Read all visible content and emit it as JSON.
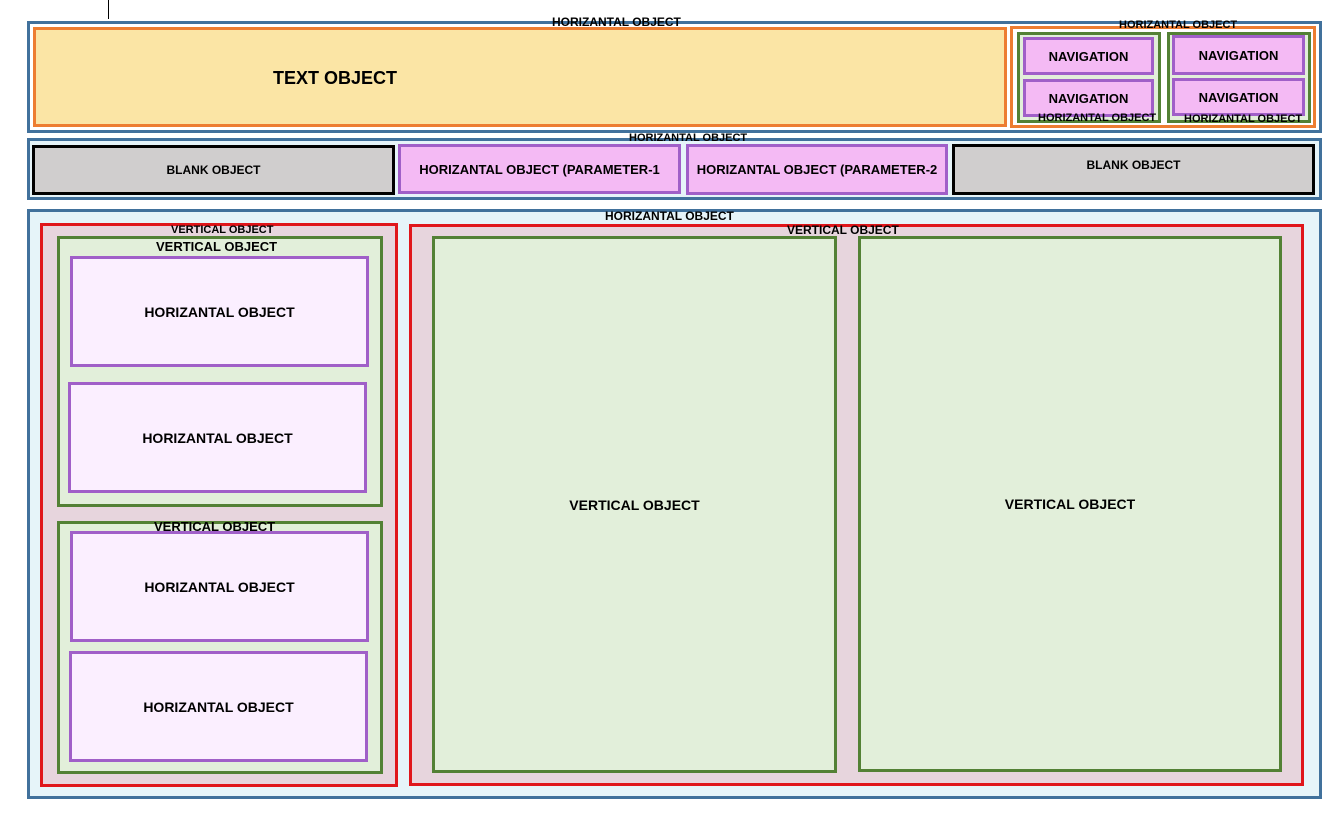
{
  "top_section": {
    "title": "HORIZANTAL OBJECT",
    "text_object": "TEXT OBJECT",
    "nav_group": {
      "title": "HORIZANTAL OBJECT",
      "left_column": {
        "title": "HORIZANTAL OBJECT",
        "items": [
          "NAVIGATION",
          "NAVIGATION"
        ]
      },
      "right_column": {
        "title": "HORIZANTAL OBJECT",
        "items": [
          "NAVIGATION",
          "NAVIGATION"
        ]
      }
    }
  },
  "parameter_bar": {
    "title": "HORIZANTAL OBJECT",
    "items": [
      "BLANK OBJECT",
      "HORIZANTAL OBJECT (PARAMETER-1",
      "HORIZANTAL OBJECT (PARAMETER-2",
      "BLANK OBJECT"
    ]
  },
  "main_section": {
    "title": "HORIZANTAL OBJECT",
    "left_panel": {
      "title": "VERTICAL OBJECT",
      "groups": [
        {
          "title": "VERTICAL OBJECT",
          "items": [
            "HORIZANTAL OBJECT",
            "HORIZANTAL OBJECT"
          ]
        },
        {
          "title": "VERTICAL OBJECT",
          "items": [
            "HORIZANTAL OBJECT",
            "HORIZANTAL OBJECT"
          ]
        }
      ]
    },
    "right_panel": {
      "title": "VERTICAL OBJECT",
      "columns": [
        "VERTICAL OBJECT",
        "VERTICAL OBJECT"
      ]
    }
  },
  "colors": {
    "container_border": "#41719c",
    "container_fill_light": "#e6f4f9",
    "text_object_fill": "#fbe5a5",
    "text_object_border": "#ed7d31",
    "nav_fill": "#f4baf4",
    "nav_border": "#a05fc8",
    "green_border": "#538135",
    "green_fill": "#e2efda",
    "red_border": "#e0161b",
    "red_fill": "#e7d5dd",
    "blank_fill": "#d0cece",
    "light_pink_fill": "#fbefff"
  }
}
